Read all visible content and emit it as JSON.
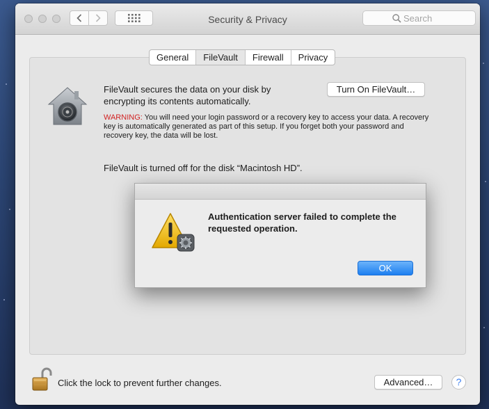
{
  "window": {
    "title": "Security & Privacy"
  },
  "search": {
    "placeholder": "Search"
  },
  "tabs": [
    "General",
    "FileVault",
    "Firewall",
    "Privacy"
  ],
  "selected_tab": "FileVault",
  "filevault": {
    "description": "FileVault secures the data on your disk by encrypting its contents automatically.",
    "turn_on_label": "Turn On FileVault…",
    "warning_label": "WARNING:",
    "warning_text": " You will need your login password or a recovery key to access your data. A recovery key is automatically generated as part of this setup. If you forget both your password and recovery key, the data will be lost.",
    "status_text": "FileVault is turned off for the disk “Macintosh HD”."
  },
  "footer": {
    "lock_text": "Click the lock to prevent further changes.",
    "advanced_label": "Advanced…",
    "help_label": "?"
  },
  "dialog": {
    "message": "Authentication server failed to complete the requested operation.",
    "ok_label": "OK"
  },
  "colors": {
    "warning": "#d12222",
    "accent": "#1d7ff0"
  }
}
